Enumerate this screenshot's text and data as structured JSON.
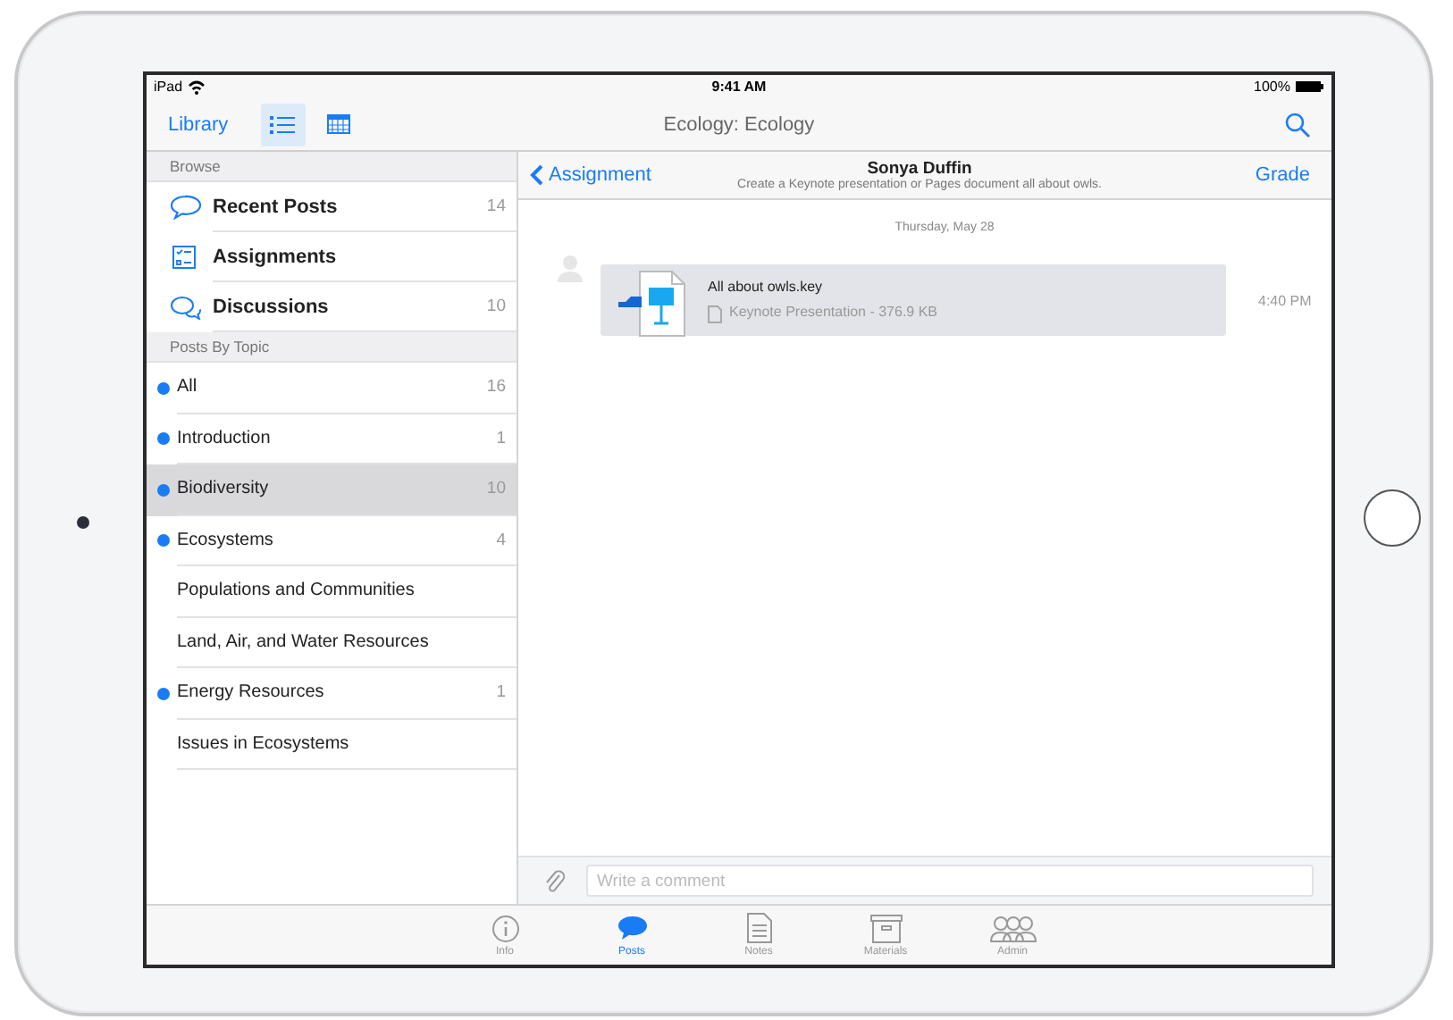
{
  "status_bar": {
    "device": "iPad",
    "time": "9:41 AM",
    "battery": "100%"
  },
  "nav_bar": {
    "back": "Library",
    "view_buttons": [
      {
        "kind": "list",
        "selected": true
      },
      {
        "kind": "calendar",
        "selected": false
      }
    ],
    "title": "Ecology: Ecology"
  },
  "sidebar": {
    "browse_header": "Browse",
    "browse_items": [
      {
        "kind": "posts",
        "label": "Recent Posts",
        "count": "14"
      },
      {
        "kind": "assignments",
        "label": "Assignments"
      },
      {
        "kind": "discussions",
        "label": "Discussions",
        "count": "10"
      }
    ],
    "topics_header": "Posts By Topic",
    "topics": [
      {
        "label": "All",
        "count": "16",
        "unread": true,
        "selected": false
      },
      {
        "label": "Introduction",
        "count": "1",
        "unread": true,
        "selected": false
      },
      {
        "label": "Biodiversity",
        "count": "10",
        "unread": true,
        "selected": true
      },
      {
        "label": "Ecosystems",
        "count": "4",
        "unread": true,
        "selected": false
      },
      {
        "label": "Populations and Communities",
        "unread": false,
        "selected": false
      },
      {
        "label": "Land, Air, and Water Resources",
        "unread": false,
        "selected": false
      },
      {
        "label": "Energy Resources",
        "count": "1",
        "unread": true,
        "selected": false
      },
      {
        "label": "Issues in Ecosystems",
        "unread": false,
        "selected": false
      }
    ]
  },
  "detail": {
    "back": "Assignment",
    "name": "Sonya Duffin",
    "subtitle": "Create a Keynote presentation or Pages document all about owls.",
    "action": "Grade",
    "date": "Thursday, May 28",
    "attachment": {
      "filename": "All about owls.key",
      "info": "Keynote Presentation - 376.9 KB",
      "time": "4:40 PM"
    },
    "comment": {
      "placeholder": "Write a comment"
    }
  },
  "tab_bar": [
    {
      "kind": "info",
      "label": "Info",
      "selected": false
    },
    {
      "kind": "posts",
      "label": "Posts",
      "selected": true
    },
    {
      "kind": "notes",
      "label": "Notes",
      "selected": false
    },
    {
      "kind": "materials",
      "label": "Materials",
      "selected": false
    },
    {
      "kind": "admin",
      "label": "Admin",
      "selected": false
    }
  ]
}
